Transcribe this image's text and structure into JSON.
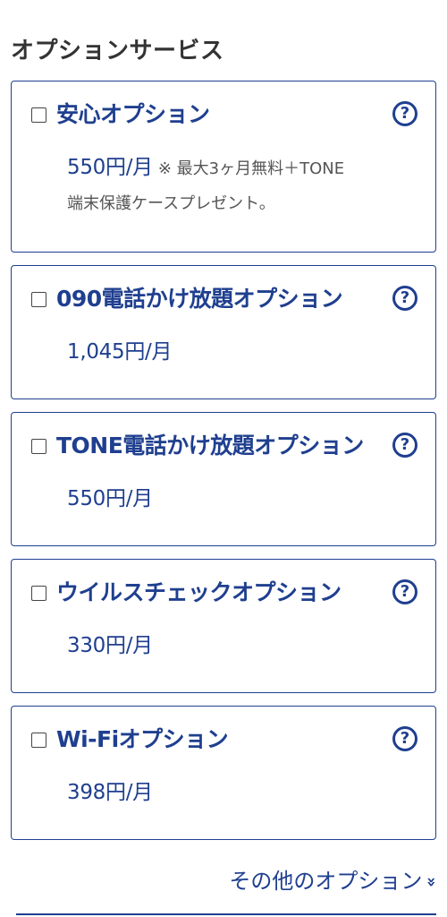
{
  "section_title": "オプションサービス",
  "options": [
    {
      "name": "安心オプション",
      "price": "550円/月",
      "note": "※ 最大3ヶ月無料＋TONE",
      "note2": "端末保護ケースプレゼント。",
      "help": "?"
    },
    {
      "name": "090電話かけ放題オプション",
      "price": "1,045円/月",
      "help": "?"
    },
    {
      "name": "TONE電話かけ放題オプション",
      "price": "550円/月",
      "help": "?"
    },
    {
      "name": "ウイルスチェックオプション",
      "price": "330円/月",
      "help": "?"
    },
    {
      "name": "Wi-Fiオプション",
      "price": "398円/月",
      "help": "?"
    }
  ],
  "more_options_label": "その他のオプション",
  "colors": {
    "accent": "#1f3f8f",
    "title_text": "#333333",
    "note_text": "#555555"
  },
  "icons": {
    "help": "question-circle-icon",
    "more": "double-chevron-down-icon"
  }
}
